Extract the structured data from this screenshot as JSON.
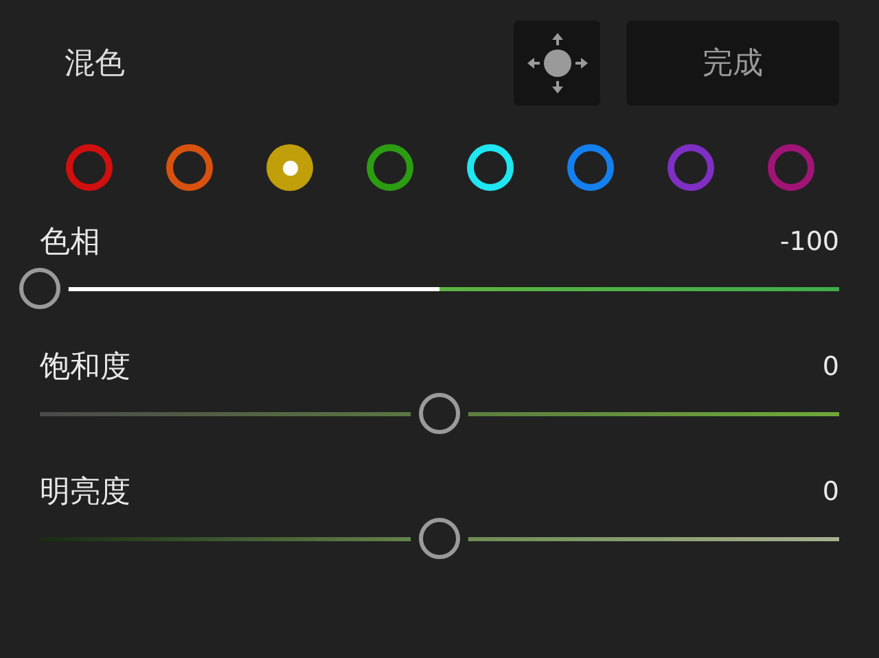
{
  "header": {
    "title": "混色",
    "done_button": "完成"
  },
  "swatches": [
    {
      "color": "#d00f0f",
      "selected": false
    },
    {
      "color": "#d8520f",
      "selected": false
    },
    {
      "color": "#c19f0a",
      "selected": true
    },
    {
      "color": "#2c9c12",
      "selected": false
    },
    {
      "color": "#1fe6f0",
      "selected": false
    },
    {
      "color": "#1480f0",
      "selected": false
    },
    {
      "color": "#7f2fc4",
      "selected": false
    },
    {
      "color": "#a01476",
      "selected": false
    }
  ],
  "sliders": [
    {
      "kind": "hue",
      "label": "色相",
      "reading": "-100",
      "level": 0
    },
    {
      "kind": "saturation",
      "label": "饱和度",
      "reading": "0",
      "level": 0.5
    },
    {
      "kind": "luminance",
      "label": "明亮度",
      "reading": "0",
      "level": 0.5
    }
  ]
}
